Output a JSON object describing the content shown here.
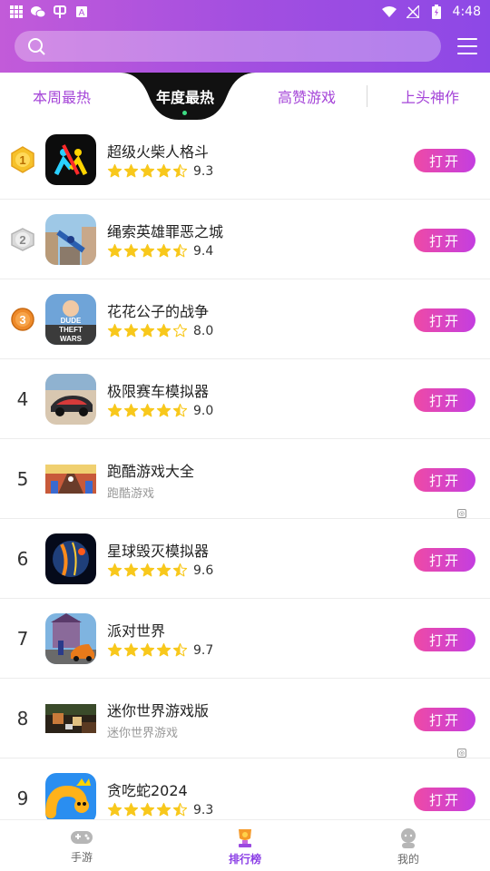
{
  "status_bar": {
    "time": "4:48"
  },
  "search": {
    "placeholder": ""
  },
  "tabs": [
    {
      "label": "本周最热",
      "active": false
    },
    {
      "label": "年度最热",
      "active": true
    },
    {
      "label": "高赞游戏",
      "active": false
    },
    {
      "label": "上头神作",
      "active": false
    }
  ],
  "list": [
    {
      "rank": "1",
      "name": "超级火柴人格斗",
      "stars": 4.5,
      "score": "9.3",
      "button": "打开",
      "icon": "stickman-fight-icon"
    },
    {
      "rank": "2",
      "name": "绳索英雄罪恶之城",
      "stars": 4.5,
      "score": "9.4",
      "button": "打开",
      "icon": "rope-hero-icon"
    },
    {
      "rank": "3",
      "name": "花花公子的战争",
      "stars": 4,
      "score": "8.0",
      "button": "打开",
      "icon": "dude-theft-wars-icon"
    },
    {
      "rank": "4",
      "name": "极限赛车模拟器",
      "stars": 4.5,
      "score": "9.0",
      "button": "打开",
      "icon": "racing-car-icon"
    },
    {
      "rank": "5",
      "name": "跑酷游戏大全",
      "subtitle": "跑酷游戏",
      "button": "打开",
      "icon": "parkour-banner"
    },
    {
      "rank": "6",
      "name": "星球毁灭模拟器",
      "stars": 4.5,
      "score": "9.6",
      "button": "打开",
      "icon": "planet-destroy-icon"
    },
    {
      "rank": "7",
      "name": "派对世界",
      "stars": 4.5,
      "score": "9.7",
      "button": "打开",
      "icon": "party-world-icon"
    },
    {
      "rank": "8",
      "name": "迷你世界游戏版",
      "subtitle": "迷你世界游戏",
      "button": "打开",
      "icon": "mini-world-banner"
    },
    {
      "rank": "9",
      "name": "贪吃蛇2024",
      "stars": 4.5,
      "score": "9.3",
      "button": "打开",
      "icon": "snake-icon"
    }
  ],
  "bottom_nav": [
    {
      "label": "手游",
      "icon": "gamepad-icon",
      "active": false
    },
    {
      "label": "排行榜",
      "icon": "trophy-icon",
      "active": true
    },
    {
      "label": "我的",
      "icon": "profile-icon",
      "active": false
    }
  ],
  "colors": {
    "header_start": "#c25bd9",
    "header_end": "#8d48e6",
    "accent": "#a545d8",
    "button_start": "#ee4aa6",
    "button_end": "#c43ee0",
    "star": "#f8c81c"
  }
}
